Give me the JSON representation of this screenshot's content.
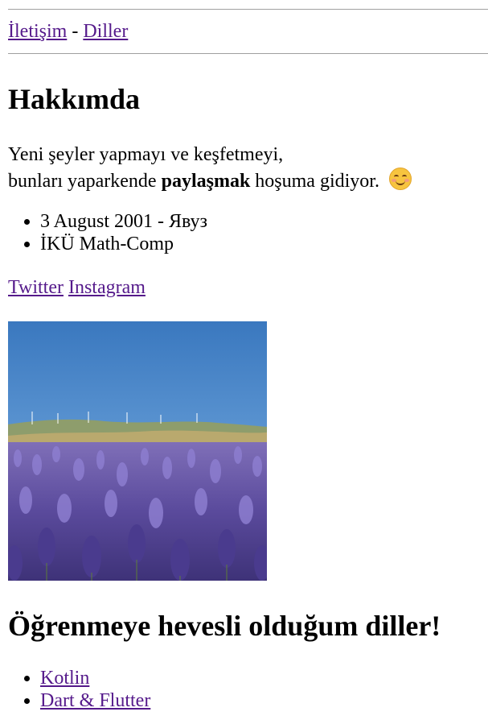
{
  "nav": {
    "links": [
      "İletişim",
      "Diller"
    ],
    "separator": "-"
  },
  "about": {
    "title": "Hakkımda",
    "intro_line1": "Yeni şeyler yapmayı ve keşfetmeyi,",
    "intro_line2_before": "bunları yaparkende ",
    "intro_bold": "paylaşmak",
    "intro_line2_after": " hoşuma gidiyor.",
    "emoji_icon": "smiling-face-icon"
  },
  "info": [
    "3 August 2001 - Явуз",
    "İKÜ Math-Comp"
  ],
  "social": [
    "Twitter",
    "Instagram"
  ],
  "photo": {
    "subject": "lavender field photo",
    "colors": {
      "sky": "#3d7cc1",
      "lavender": "#6a56b8",
      "hills": "#8a9a6a"
    }
  },
  "languages": {
    "title": "Öğrenmeye hevesli olduğum diller!",
    "items": [
      "Kotlin",
      "Dart & Flutter"
    ]
  },
  "colors": {
    "link": "#551a8b",
    "rule": "#a0a0a0"
  }
}
